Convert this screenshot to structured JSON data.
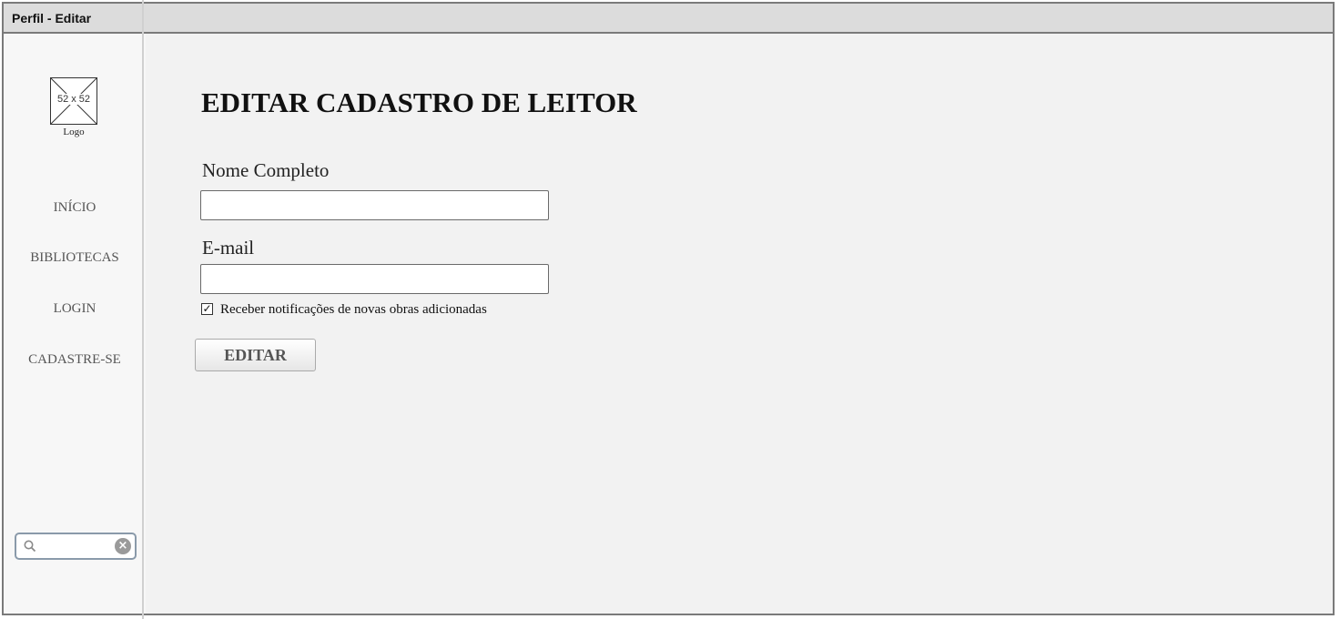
{
  "window": {
    "title": "Perfil - Editar"
  },
  "sidebar": {
    "logo_size_label": "52 x 52",
    "logo_caption": "Logo",
    "items": [
      {
        "label": "INÍCIO"
      },
      {
        "label": "BIBLIOTECAS"
      },
      {
        "label": "LOGIN"
      },
      {
        "label": "CADASTRE-SE"
      }
    ],
    "search": {
      "placeholder": "",
      "value": ""
    }
  },
  "main": {
    "title": "EDITAR CADASTRO DE LEITOR",
    "fields": {
      "name": {
        "label": "Nome Completo",
        "value": ""
      },
      "email": {
        "label": "E-mail",
        "value": ""
      }
    },
    "notify": {
      "label": "Receber notificações de novas obras adicionadas",
      "checked": true
    },
    "edit_button": "EDITAR"
  }
}
